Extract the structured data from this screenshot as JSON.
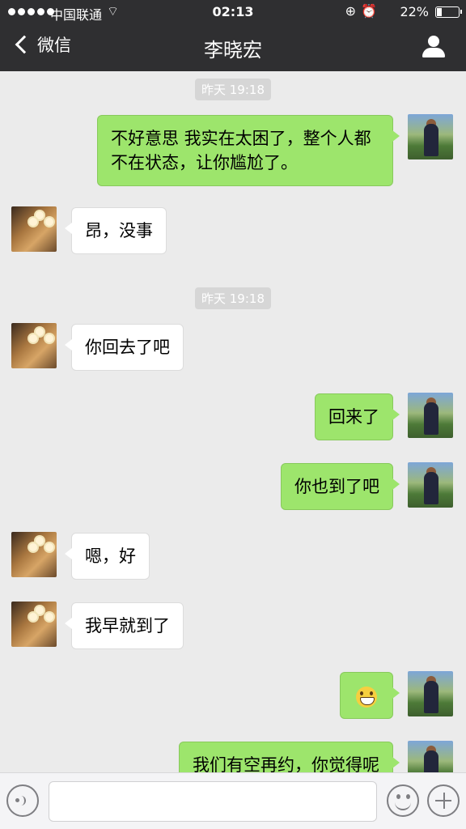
{
  "status_bar": {
    "carrier": "中国联通",
    "time": "02:13",
    "battery": "22%",
    "battery_level": 0.22
  },
  "nav": {
    "back_label": "微信",
    "title": "李晓宏"
  },
  "messages": [
    {
      "type": "time",
      "text": "昨天 19:18"
    },
    {
      "type": "out",
      "text": "不好意思  我实在太困了，整个人都不在状态，让你尴尬了。"
    },
    {
      "type": "in",
      "text": "昂，没事"
    },
    {
      "type": "time",
      "text": "昨天 19:18"
    },
    {
      "type": "in",
      "text": "你回去了吧"
    },
    {
      "type": "out",
      "text": "回来了"
    },
    {
      "type": "out",
      "text": "你也到了吧"
    },
    {
      "type": "in",
      "text": "嗯，好"
    },
    {
      "type": "in",
      "text": "我早就到了"
    },
    {
      "type": "out",
      "emoji": "grin-emoji"
    },
    {
      "type": "out",
      "text": "我们有空再约，你觉得呢"
    }
  ],
  "input": {
    "placeholder": ""
  },
  "colors": {
    "nav_bg": "#2f2f31",
    "chat_bg": "#ebebeb",
    "outgoing_bubble": "#9de56c",
    "incoming_bubble": "#ffffff"
  },
  "icons": [
    "back-chevron-icon",
    "profile-icon",
    "voice-icon",
    "emoji-icon",
    "plus-icon",
    "wifi-icon",
    "lock-rotation-icon",
    "alarm-icon",
    "battery-icon"
  ]
}
